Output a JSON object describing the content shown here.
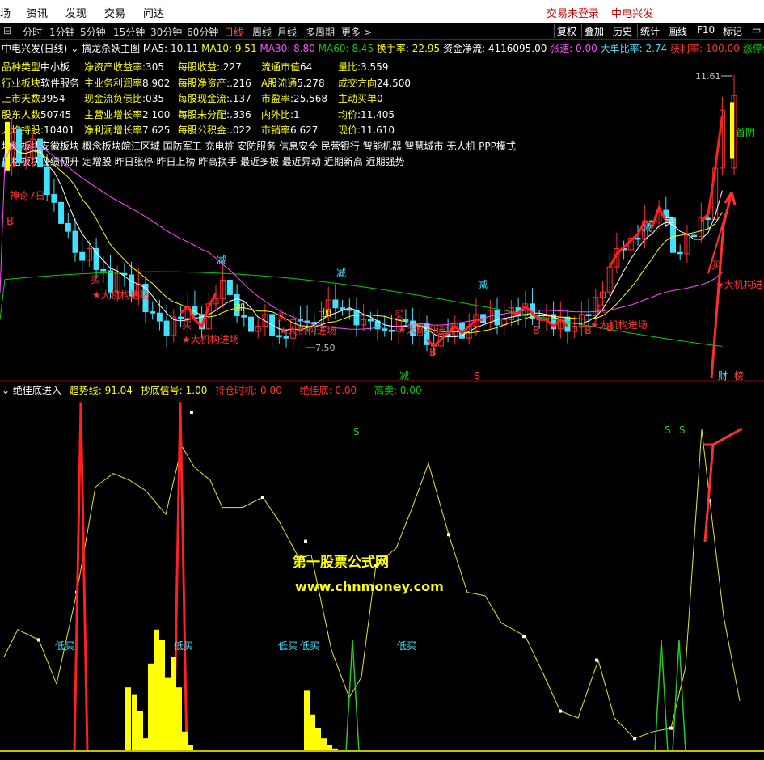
{
  "menu": {
    "left": [
      "场",
      "资讯",
      "发现",
      "交易",
      "问达"
    ],
    "right": [
      "交易未登录",
      "中电兴发"
    ]
  },
  "tabs": {
    "items": [
      "分时",
      "1分钟",
      "5分钟",
      "15分钟",
      "30分钟",
      "60分钟",
      "日线",
      "周线",
      "月线",
      "多周期",
      "更多 >"
    ],
    "active": "日线",
    "right": [
      "复权",
      "叠加",
      "历史",
      "统计",
      "画线",
      "F10",
      "标记"
    ]
  },
  "main_title": {
    "stock": "中电兴发(日线)",
    "indicator": "擒龙杀妖主图",
    "ma5": "MA5: 10.11",
    "ma10": "MA10: 9.51",
    "ma30": "MA30: 8.80",
    "ma60": "MA60: 8.45",
    "turnover": "换手率: 22.95",
    "fund_flow": "资金净流: 4116095.00",
    "speed": "张速: 0.00",
    "big_ratio": "大单比率: 2.74",
    "profit": "获利率: 100.00",
    "limit": "涨停价: "
  },
  "info": {
    "rows": [
      [
        [
          "品种类型",
          "中小板"
        ],
        [
          "净资产收益率",
          ":305"
        ],
        [
          "每股收益",
          ":.227"
        ],
        [
          "流通市值",
          "64"
        ],
        [
          "量比",
          ":3.559"
        ]
      ],
      [
        [
          "行业板块",
          "软件服务"
        ],
        [
          "主业务利润率",
          "8.902"
        ],
        [
          "每股净资产",
          ":.216"
        ],
        [
          "A股流通",
          "5.278"
        ],
        [
          "成交方向",
          "24.500"
        ]
      ],
      [
        [
          "上市天数",
          "3954"
        ],
        [
          "现金流负债比",
          ":035"
        ],
        [
          "每股现金流",
          ":.137"
        ],
        [
          "市盈率",
          ":25.568"
        ],
        [
          "主动买单",
          "0"
        ]
      ],
      [
        [
          "股东人数",
          "50745"
        ],
        [
          "主营业增长率",
          "2.100"
        ],
        [
          "每股未分配",
          ":.336"
        ],
        [
          "内外比",
          ":1"
        ],
        [
          "均价",
          ":11.405"
        ]
      ],
      [
        [
          "人均持股",
          ":10401"
        ],
        [
          "净利润增长率",
          "7.625"
        ],
        [
          "每股公积金",
          ":.022"
        ],
        [
          "市销率",
          "6.627"
        ],
        [
          "现价",
          ":11.610"
        ]
      ]
    ],
    "concept": "地域板块安徽板块  概念板块皖江区域 国防军工 充电桩 安防服务 信息安全 民营银行 智能机器 智慧城市 无人机 PPP模式",
    "style": "风格板块业绩预升 定增股 昨日张停 昨日上榜 昨高换手 最近多板 最近异动 近期新高 近期强势"
  },
  "chart_labels": {
    "high": "11.61",
    "low": "7.50",
    "first_yin": "首阴",
    "magic": "神奇7日",
    "buy": "买",
    "sell": "卖",
    "reduce": "减",
    "add": "加",
    "b": "B",
    "s": "S",
    "inst": "★大机构进场",
    "cai": "财",
    "bang": "榜"
  },
  "sub_title": {
    "name": "绝佳底进入",
    "trend": "趋势线: 91.04",
    "bottom": "抄底信号: 1.00",
    "hold": "持仓时机: 0.00",
    "best": "绝佳底: 0.00",
    "high_sell": "高卖: 0.00"
  },
  "sub_labels": {
    "low_buy": "低买",
    "s": "S"
  },
  "watermark": {
    "line1": "第一股票公式网",
    "line2": "www.chnmoney.com"
  },
  "chart_data": [
    {
      "type": "candlestick",
      "title": "中电兴发(日线)",
      "y_range": [
        7.5,
        11.61
      ],
      "annotations": [
        "11.61",
        "7.50",
        "首阴",
        "神奇7日"
      ],
      "series": [
        {
          "name": "MA5",
          "last": 10.11
        },
        {
          "name": "MA10",
          "last": 9.51
        },
        {
          "name": "MA30",
          "last": 8.8
        },
        {
          "name": "MA60",
          "last": 8.45
        }
      ]
    },
    {
      "type": "line",
      "title": "绝佳底进入",
      "series": [
        {
          "name": "趋势线",
          "last": 91.04
        }
      ],
      "y_range": [
        0,
        100
      ]
    }
  ],
  "colors": {
    "up": "#ff3030",
    "down": "#40e0ff",
    "ma5": "#ffffff",
    "ma10": "#ffff00",
    "ma30": "#ff50ff",
    "ma60": "#00d000",
    "signal": "#ffff00"
  }
}
